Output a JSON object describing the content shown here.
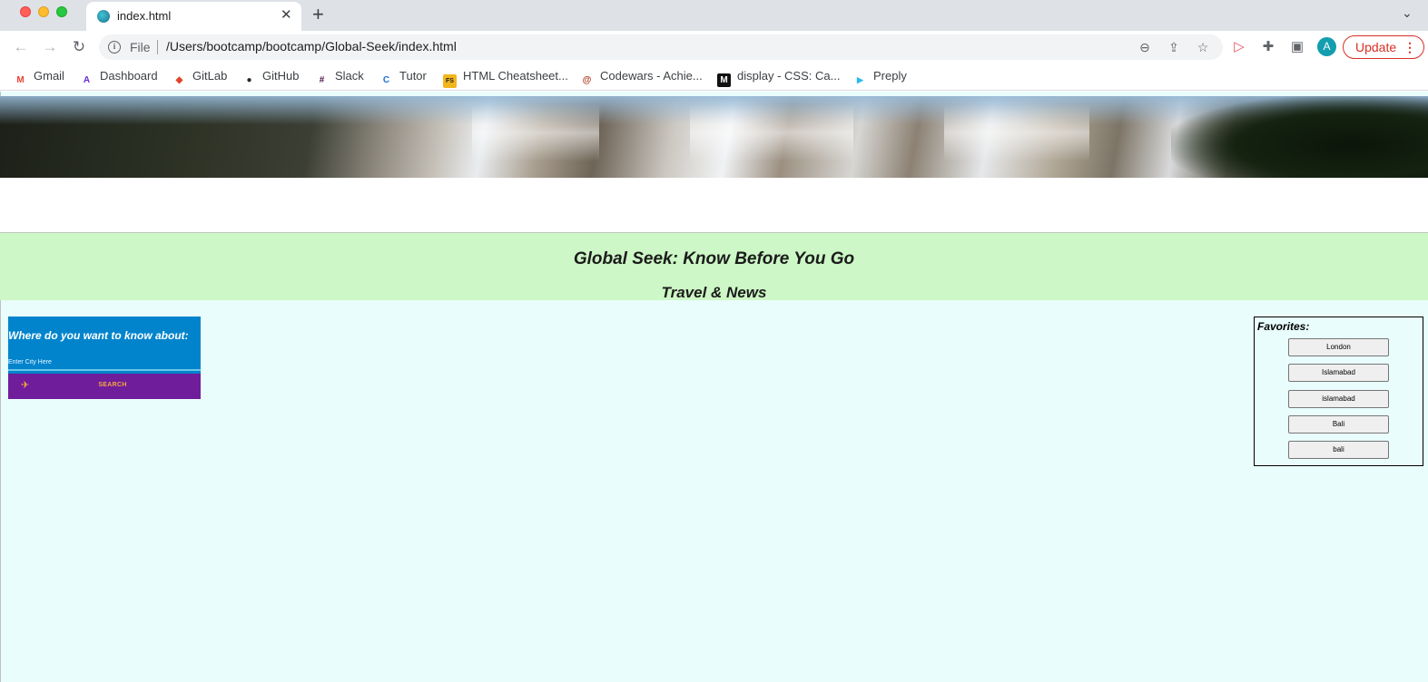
{
  "browser": {
    "tab": {
      "title": "index.html",
      "close": "✕"
    },
    "new_tab": "+",
    "omnibox": {
      "scheme": "File",
      "url": "/Users/bootcamp/bootcamp/Global-Seek/index.html"
    },
    "profile_initial": "A",
    "update_label": "Update",
    "bookmarks": [
      {
        "label": "Gmail",
        "icon": "gmail-icon",
        "glyph": "M",
        "color": "#ea4335"
      },
      {
        "label": "Dashboard",
        "icon": "dashboard-icon",
        "glyph": "A",
        "color": "#6b2bd6"
      },
      {
        "label": "GitLab",
        "icon": "gitlab-icon",
        "glyph": "◆",
        "color": "#e24329"
      },
      {
        "label": "GitHub",
        "icon": "github-icon",
        "glyph": "●",
        "color": "#24292e"
      },
      {
        "label": "Slack",
        "icon": "slack-icon",
        "glyph": "#",
        "color": "#4a154b"
      },
      {
        "label": "Tutor",
        "icon": "tutor-icon",
        "glyph": "C",
        "color": "#1e6fd9"
      },
      {
        "label": "HTML Cheatsheet...",
        "icon": "cheatsheet-icon",
        "glyph": "FS",
        "color": "#f2b51d"
      },
      {
        "label": "Codewars - Achie...",
        "icon": "codewars-icon",
        "glyph": "@",
        "color": "#b1361e"
      },
      {
        "label": "display - CSS: Ca...",
        "icon": "mdn-icon",
        "glyph": "M",
        "color": "#111111"
      },
      {
        "label": "Preply",
        "icon": "preply-icon",
        "glyph": "▶",
        "color": "#2ab8f0"
      }
    ]
  },
  "page": {
    "banner_title": "Global Seek: Know Before You Go",
    "banner_subtitle": "Travel & News",
    "search": {
      "heading": "Where do you want to know about:",
      "placeholder": "Enter City Here",
      "button_label": "SEARCH",
      "button_icon": "plane-icon"
    },
    "favorites": {
      "heading": "Favorites:",
      "items": [
        "London",
        "Islamabad",
        "islamabad",
        "Bali",
        "bali"
      ]
    }
  }
}
